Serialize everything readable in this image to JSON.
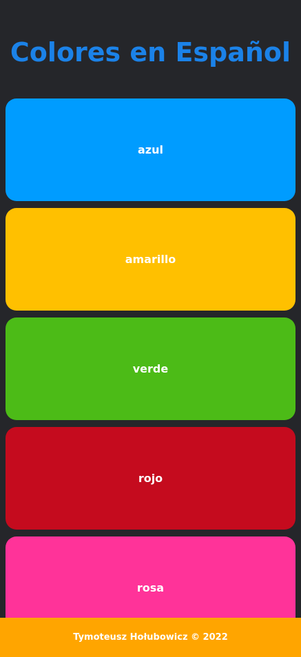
{
  "header": {
    "title": "Colores en Español",
    "title_color": "#1b82e8"
  },
  "colors": [
    {
      "label": "azul",
      "color": "#009cff"
    },
    {
      "label": "amarillo",
      "color": "#ffc000"
    },
    {
      "label": "verde",
      "color": "#4cbb17"
    },
    {
      "label": "rojo",
      "color": "#c50b1e"
    },
    {
      "label": "rosa",
      "color": "#ff3399"
    }
  ],
  "footer": {
    "text": "Tymoteusz Hołubowicz © 2022",
    "color": "#ffa500"
  },
  "page": {
    "background": "#25262a"
  }
}
